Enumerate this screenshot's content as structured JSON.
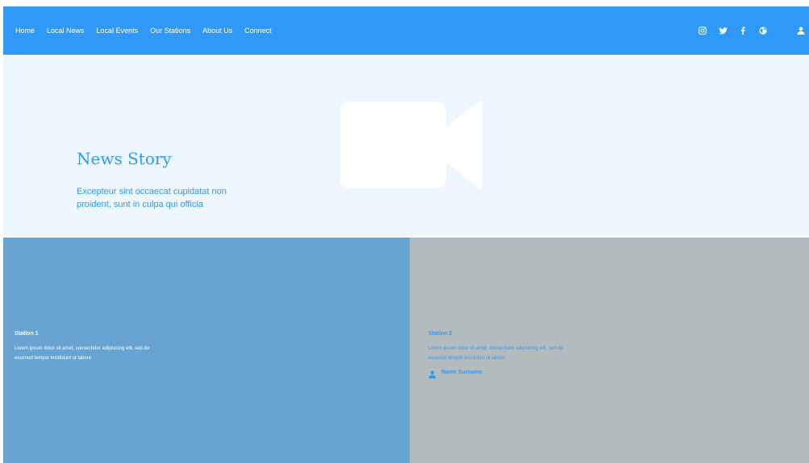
{
  "nav": {
    "links": [
      "Home",
      "Local News",
      "Local Events",
      "Our Stations",
      "About Us",
      "Connect"
    ],
    "icons": [
      "instagram-icon",
      "twitter-icon",
      "facebook-icon",
      "globe-icon"
    ],
    "user_icon": "user-icon"
  },
  "hero": {
    "media_icon": "video-camera-icon",
    "title": "News Story",
    "text": "Excepteur sint occaecat cupidatat non proident, sunt in culpa qui officia"
  },
  "stations": [
    {
      "title": "Station 1",
      "text": "Lorem ipsum dolor sit amet, consectetur adipisicing elit, sed do eiusmod tempor incididunt ut labore"
    },
    {
      "title": "Station 2",
      "text": "Lorem ipsum dolor sit amet, consectetur adipisicing elit, sed do eiusmod tempor incididunt ut labore",
      "author": "Name Surname"
    }
  ],
  "colors": {
    "primary": "#2f99f7",
    "hero_background": "#eef7ff",
    "station_1_background": "#67a4d1",
    "station_2_background": "#b4bbbf"
  }
}
